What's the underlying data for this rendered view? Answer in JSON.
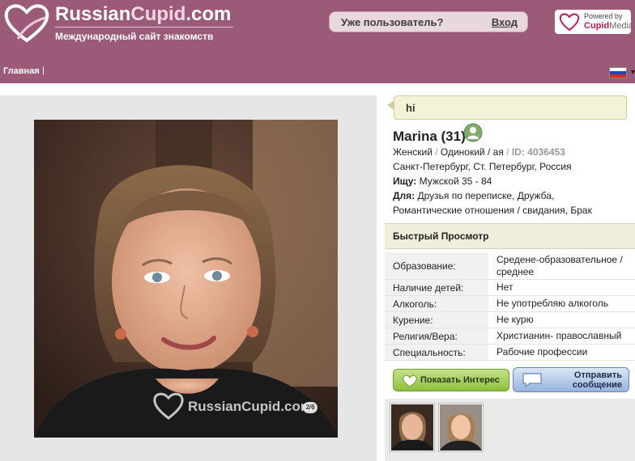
{
  "brand": {
    "logo_prefix": "Russian",
    "logo_suffix": "Cupid",
    "logo_domain": ".com",
    "tagline": "Международный сайт знакомств"
  },
  "login": {
    "question": "Уже пользователь?",
    "link": "Вход"
  },
  "powered": {
    "by": "Powered by",
    "name_a": "Cupid",
    "name_b": "Media"
  },
  "nav": {
    "home": "Главная",
    "separator": "|",
    "language_flag": "russia-flag-icon"
  },
  "photo": {
    "watermark": "RussianCupid.com",
    "count": "2/6"
  },
  "profile": {
    "headline": "hi",
    "name": "Marina (31)",
    "gender": "Женский",
    "relationship": "Одинокий / ая",
    "id": "ID: 4036453",
    "location": "Санкт-Петербург, Ст. Петербург, Россия",
    "seeking_label": "Ищу:",
    "seeking_value": "Мужской 35 - 84",
    "for_label": "Для:",
    "for_value_line1": "Друзья по переписке, Дружба,",
    "for_value_line2": "Романтические отношения / свидания, Брак"
  },
  "quick_view": {
    "title": "Быстрый Просмотр",
    "rows": [
      {
        "label": "Образование:",
        "value": "Средене-образовательное / среднее"
      },
      {
        "label": "Наличие детей:",
        "value": "Нет"
      },
      {
        "label": "Алкоголь:",
        "value": "Не употребляю алкоголь"
      },
      {
        "label": "Курение:",
        "value": "Не курю"
      },
      {
        "label": "Религия/Вера:",
        "value": "Христианин- православный"
      },
      {
        "label": "Специальность:",
        "value": "Рабочие профессии"
      }
    ]
  },
  "actions": {
    "interest": "Показать Интерес",
    "message_line1": "Отправить",
    "message_line2": "сообщение"
  },
  "colors": {
    "header": "#9c5a79",
    "accent_green": "#8bbf3e",
    "accent_blue": "#98b3dc"
  }
}
